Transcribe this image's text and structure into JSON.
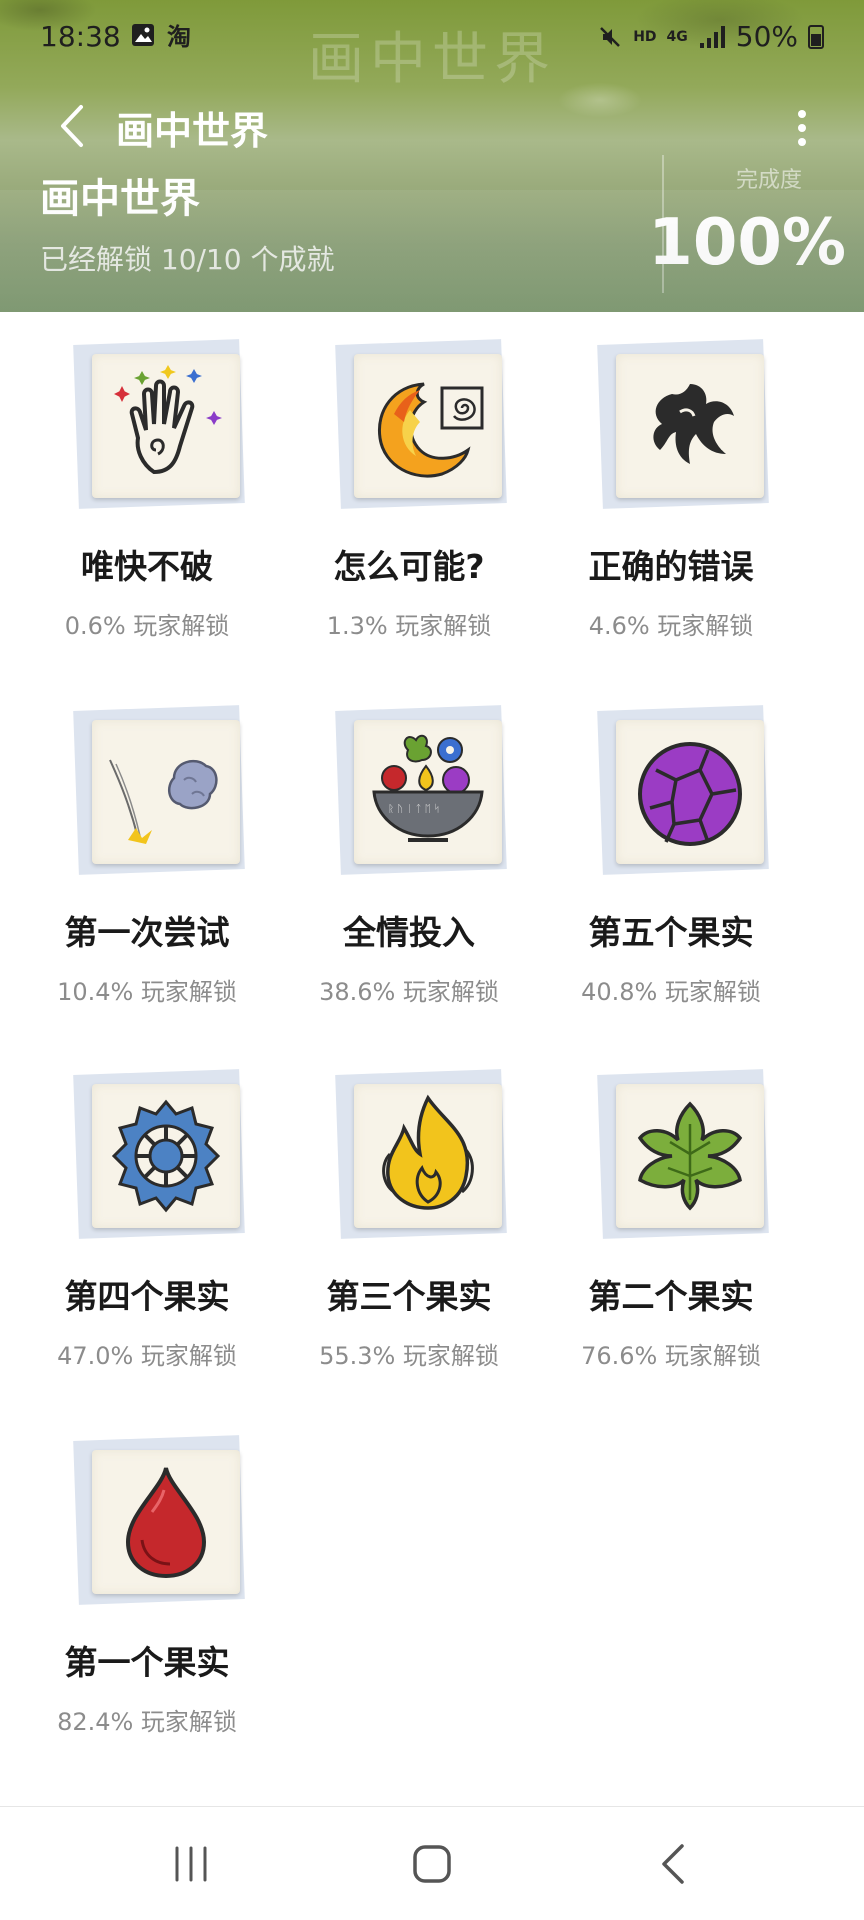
{
  "status_bar": {
    "time": "18:38",
    "hd": "HD",
    "network": "4G",
    "battery": "50%"
  },
  "header": {
    "watermark": "画中世界",
    "app_bar_title": "画中世界",
    "game_title": "画中世界",
    "unlock_status": "已经解锁 10/10 个成就",
    "completion_label": "完成度",
    "completion_value": "100%"
  },
  "achievements": [
    {
      "name": "唯快不破",
      "percent": "0.6% 玩家解锁",
      "icon": "rainbow-hand-icon"
    },
    {
      "name": "怎么可能?",
      "percent": "1.3% 玩家解锁",
      "icon": "fire-spiral-icon"
    },
    {
      "name": "正确的错误",
      "percent": "4.6% 玩家解锁",
      "icon": "ink-tentacle-icon"
    },
    {
      "name": "第一次尝试",
      "percent": "10.4% 玩家解锁",
      "icon": "rock-throw-icon"
    },
    {
      "name": "全情投入",
      "percent": "38.6% 玩家解锁",
      "icon": "fruit-bowl-icon"
    },
    {
      "name": "第五个果实",
      "percent": "40.8% 玩家解锁",
      "icon": "purple-fruit-icon"
    },
    {
      "name": "第四个果实",
      "percent": "47.0% 玩家解锁",
      "icon": "blue-gear-icon"
    },
    {
      "name": "第三个果实",
      "percent": "55.3% 玩家解锁",
      "icon": "yellow-flame-icon"
    },
    {
      "name": "第二个果实",
      "percent": "76.6% 玩家解锁",
      "icon": "green-leaf-icon"
    },
    {
      "name": "第一个果实",
      "percent": "82.4% 玩家解锁",
      "icon": "red-drop-icon"
    }
  ],
  "colors": {
    "header_green": "#93a95a",
    "title_text": "#1a1a1a",
    "muted_text": "#8c8c8c"
  }
}
